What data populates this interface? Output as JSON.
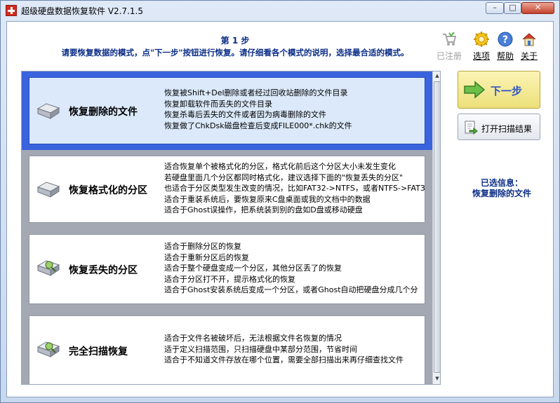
{
  "window": {
    "title": "超级硬盘数据恢复软件 V2.7.1.5"
  },
  "header": {
    "step_title": "第 1 步",
    "step_description": "请要恢复数据的模式，点\"下一步\"按钮进行恢复。请仔细看各个模式的说明，选择最合适的模式。"
  },
  "toolbar": {
    "items": [
      {
        "label": "已注册",
        "icon": "cart-icon",
        "enabled": false
      },
      {
        "label": "选项",
        "icon": "gear-icon",
        "enabled": true
      },
      {
        "label": "帮助",
        "icon": "help-icon",
        "enabled": true
      },
      {
        "label": "关于",
        "icon": "home-icon",
        "enabled": true
      }
    ]
  },
  "options": [
    {
      "title": "恢复删除的文件",
      "selected": true,
      "icon": "hard-disk-icon",
      "lines": [
        "恢复被Shift+Del删除或者经过回收站删除的文件目录",
        "恢复卸载软件而丢失的文件目录",
        "恢复杀毒后丢失的文件或者因为病毒删除的文件",
        "恢复做了ChkDsk磁盘检查后变成FILE000*.chk的文件"
      ]
    },
    {
      "title": "恢复格式化的分区",
      "selected": false,
      "icon": "hard-disk-icon",
      "lines": [
        "适合恢复单个被格式化的分区，格式化前后这个分区大小未发生变化",
        "若硬盘里面几个分区都同时格式化，建议选择下面的\"恢复丢失的分区\"",
        "也适合于分区类型发生改变的情况，比如FAT32->NTFS，或者NTFS->FAT3",
        "适合于重装系统后，要恢复原来C盘桌面或我的文档中的数据",
        "适合于Ghost误操作，把系统装到别的盘如D盘或移动硬盘"
      ]
    },
    {
      "title": "恢复丢失的分区",
      "selected": false,
      "icon": "disk-search-icon",
      "lines": [
        "适合于删除分区的恢复",
        "适合于重新分区后的恢复",
        "适合于整个硬盘变成一个分区，其他分区丢了的恢复",
        "适合于分区打不开，提示格式化的恢复",
        "适合于Ghost安装系统后变成一个分区，或者Ghost自动把硬盘分成几个分"
      ]
    },
    {
      "title": "完全扫描恢复",
      "selected": false,
      "icon": "disk-search-icon",
      "lines": [
        "适合于文件名被破坏后，无法根据文件名恢复的情况",
        "适于定义扫描范围，只扫描硬盘中某部分范围，节省时间",
        "适合于不知道文件存放在哪个位置，需要全部扫描出来再仔细查找文件"
      ]
    }
  ],
  "actions": {
    "next_label": "下一步",
    "open_scan_label": "打开扫描结果"
  },
  "selected_info": {
    "heading": "已选信息：",
    "value": "恢复删除的文件"
  },
  "colors": {
    "selected_border": "#3a63de",
    "selected_fill": "#dbe9fa",
    "header_text": "#0b2d87",
    "next_button": "#ece07a"
  }
}
